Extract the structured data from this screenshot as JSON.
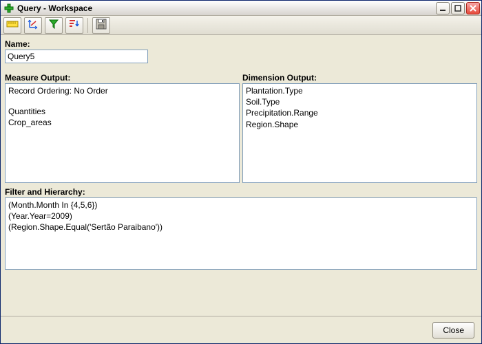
{
  "window": {
    "title": "Query - Workspace"
  },
  "toolbar": {
    "buttons": {
      "measure": "measure",
      "axes": "axes",
      "filter": "filter",
      "sort": "sort",
      "save": "save"
    }
  },
  "labels": {
    "name": "Name:",
    "measure_output": "Measure Output:",
    "dimension_output": "Dimension Output:",
    "filter_hierarchy": "Filter and Hierarchy:"
  },
  "name_input": {
    "value": "Query5"
  },
  "measure_output": {
    "ordering_line": "Record Ordering: No Order",
    "items": [
      "Quantities",
      "Crop_areas"
    ]
  },
  "dimension_output": {
    "items": [
      "Plantation.Type",
      "Soil.Type",
      "Precipitation.Range",
      "Region.Shape"
    ]
  },
  "filter_hierarchy": {
    "lines": [
      "(Month.Month In {4,5,6})",
      "(Year.Year=2009)",
      "(Region.Shape.Equal('Sertão Paraibano'))"
    ]
  },
  "footer": {
    "close_label": "Close"
  }
}
